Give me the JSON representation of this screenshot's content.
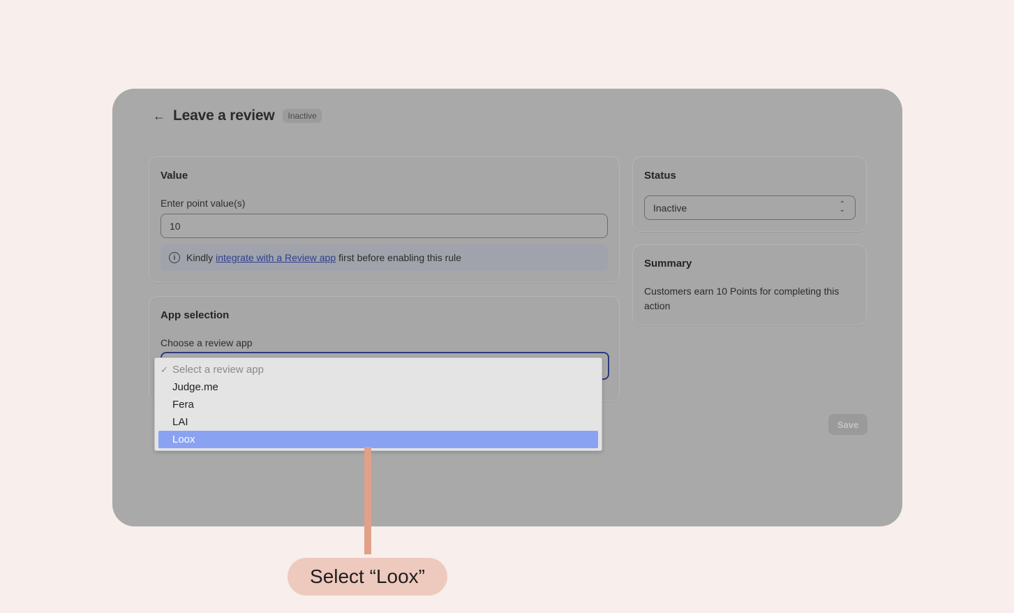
{
  "header": {
    "back_icon": "arrow-left-icon",
    "title": "Leave a review",
    "badge": "Inactive"
  },
  "value_card": {
    "title": "Value",
    "field_label": "Enter point value(s)",
    "field_value": "10",
    "banner": {
      "icon": "info-icon",
      "prefix": "Kindly",
      "link_text": "integrate with a Review app",
      "suffix": "first before enabling this rule"
    }
  },
  "app_card": {
    "title": "App selection",
    "field_label": "Choose a review app"
  },
  "dropdown": {
    "options": [
      {
        "label": "Select a review app",
        "placeholder": true,
        "checked": true
      },
      {
        "label": "Judge.me"
      },
      {
        "label": "Fera"
      },
      {
        "label": "LAI"
      },
      {
        "label": "Loox",
        "highlighted": true
      }
    ]
  },
  "status_card": {
    "title": "Status",
    "selected": "Inactive"
  },
  "summary_card": {
    "title": "Summary",
    "text": "Customers earn 10 Points for completing this action"
  },
  "save_label": "Save",
  "callout": {
    "text": "Select “Loox”"
  },
  "colors": {
    "background": "#f8eeeb",
    "overlay": "#a9a9a9",
    "highlight": "#8aa2f2",
    "callout": "#eec9bd",
    "connector": "#e0a08a"
  }
}
